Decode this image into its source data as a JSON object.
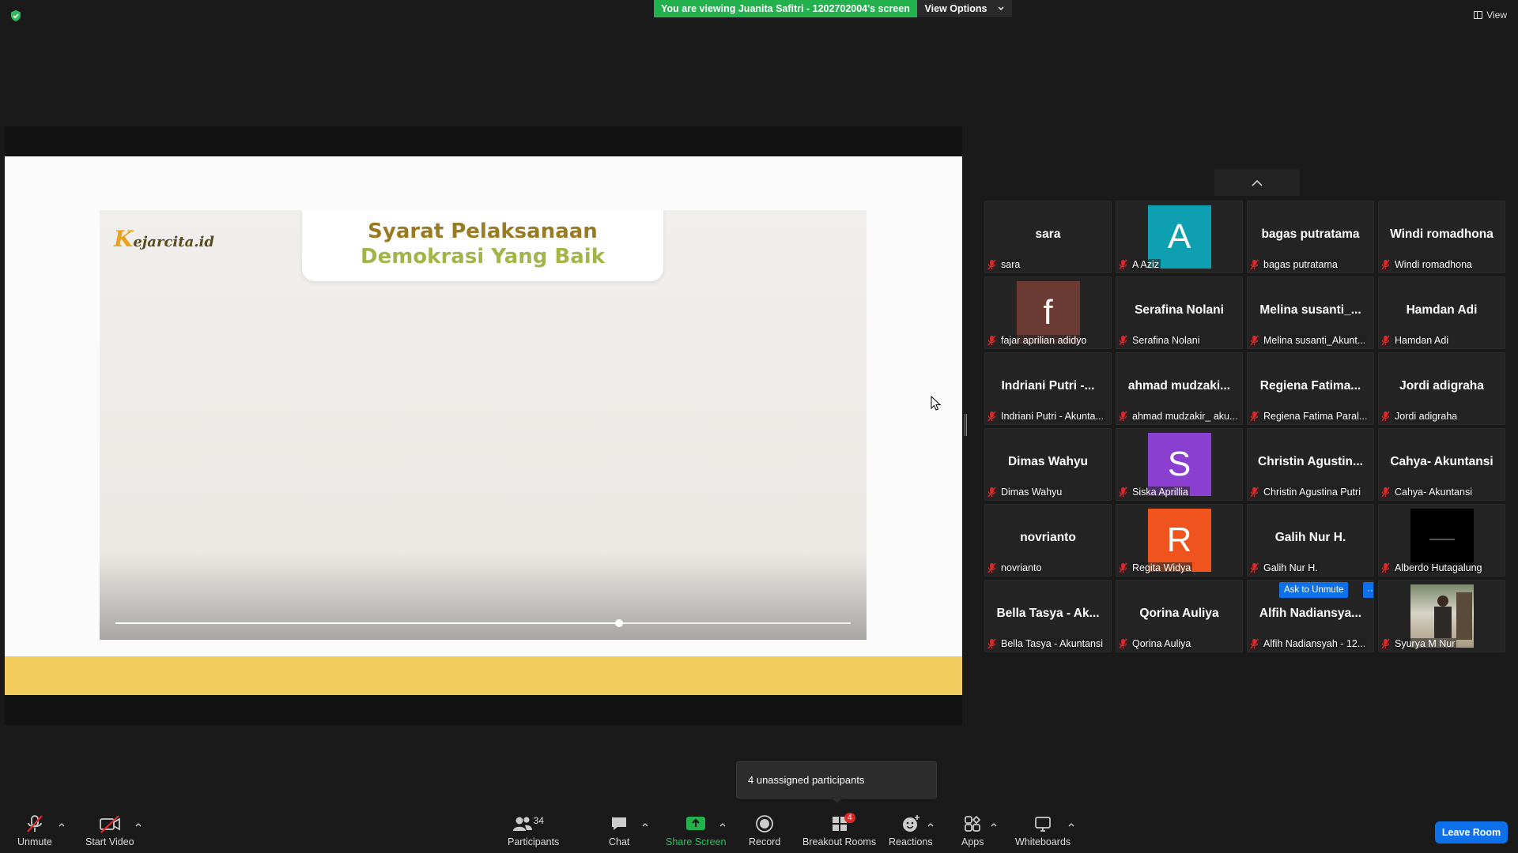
{
  "top": {
    "banner_text": "You are viewing Juanita Safitri - 1202702004's screen",
    "view_options_label": "View Options",
    "view_label": "View"
  },
  "shared_screen": {
    "logo_text": "ejarcita.id",
    "slide_title_line1": "Syarat Pelaksanaan",
    "slide_title_line2": "Demokrasi Yang Baik",
    "video_progress": 0.685
  },
  "gallery": {
    "tiles": [
      {
        "display": "sara",
        "name": "sara",
        "kind": "text"
      },
      {
        "display": "A",
        "name": "A Aziz",
        "kind": "avatar",
        "color": "#0e9fb0"
      },
      {
        "display": "bagas putratama",
        "name": "bagas putratama",
        "kind": "text"
      },
      {
        "display": "Windi romadhona",
        "name": "Windi romadhona",
        "kind": "text"
      },
      {
        "display": "f",
        "name": "fajar aprilian adidyo",
        "kind": "avatar",
        "color": "#6b3a33"
      },
      {
        "display": "Serafina Nolani",
        "name": "Serafina Nolani",
        "kind": "text"
      },
      {
        "display": "Melina susanti_...",
        "name": "Melina susanti_Akunt...",
        "kind": "text"
      },
      {
        "display": "Hamdan Adi",
        "name": "Hamdan Adi",
        "kind": "text"
      },
      {
        "display": "Indriani Putri -...",
        "name": "Indriani Putri - Akunta...",
        "kind": "text"
      },
      {
        "display": "ahmad mudzaki...",
        "name": "ahmad mudzakir_ aku...",
        "kind": "text"
      },
      {
        "display": "Regiena Fatima...",
        "name": "Regiena Fatima Paral...",
        "kind": "text"
      },
      {
        "display": "Jordi adigraha",
        "name": "Jordi adigraha",
        "kind": "text"
      },
      {
        "display": "Dimas Wahyu",
        "name": "Dimas Wahyu",
        "kind": "text"
      },
      {
        "display": "S",
        "name": "Siska Aprillia",
        "kind": "avatar",
        "color": "#8a3fd1"
      },
      {
        "display": "Christin Agustin...",
        "name": "Christin Agustina Putri",
        "kind": "text"
      },
      {
        "display": "Cahya- Akuntansi",
        "name": "Cahya- Akuntansi",
        "kind": "text"
      },
      {
        "display": "novrianto",
        "name": "novrianto",
        "kind": "text"
      },
      {
        "display": "R",
        "name": "Regita Widya",
        "kind": "avatar",
        "color": "#f0541e"
      },
      {
        "display": "Galih Nur H.",
        "name": "Galih Nur H.",
        "kind": "text"
      },
      {
        "display": "",
        "name": "Alberdo Hutagalung",
        "kind": "photo-dark"
      },
      {
        "display": "Bella Tasya - Ak...",
        "name": "Bella Tasya - Akuntansi",
        "kind": "text"
      },
      {
        "display": "Qorina Auliya",
        "name": "Qorina Auliya",
        "kind": "text"
      },
      {
        "display": "Alfih Nadiansya...",
        "name": "Alfih Nadiansyah - 12...",
        "kind": "text",
        "ask_unmute": "Ask to Unmute",
        "more": "···"
      },
      {
        "display": "",
        "name": "Syurya M Nur",
        "kind": "photo-room"
      }
    ]
  },
  "toast": {
    "text": "4 unassigned participants"
  },
  "toolbar": {
    "unmute": "Unmute",
    "start_video": "Start Video",
    "participants": "Participants",
    "participants_count": "34",
    "chat": "Chat",
    "share_screen": "Share Screen",
    "record": "Record",
    "breakout_rooms": "Breakout Rooms",
    "breakout_badge": "4",
    "reactions": "Reactions",
    "apps": "Apps",
    "whiteboards": "Whiteboards",
    "leave_room": "Leave Room"
  },
  "colors": {
    "banner_green": "#22b14c",
    "accent_blue": "#0e71eb",
    "muted_red": "#e02828",
    "slide_yellow": "#f2cc5e"
  }
}
